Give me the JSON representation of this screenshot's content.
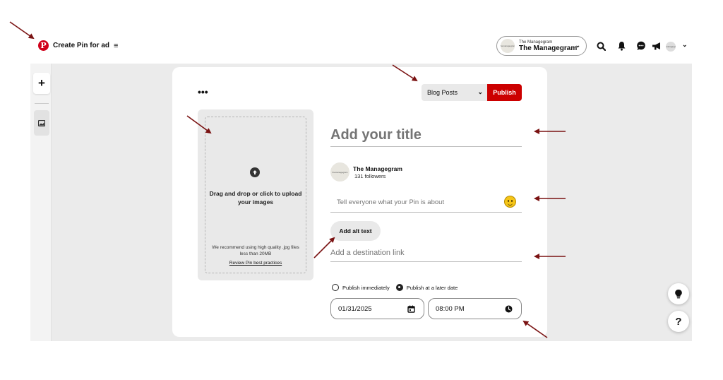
{
  "header": {
    "title": "Create Pin for ad",
    "menu_glyph": "≡",
    "logo_glyph": "P"
  },
  "account": {
    "logo_text": "themanagegram",
    "small_name": "The Managegram",
    "name": "The Managegram"
  },
  "top_icons": [
    "search-icon",
    "bell-icon",
    "chat-icon",
    "megaphone-icon"
  ],
  "avatar_text": "themanagegram",
  "rail": {
    "plus_label": "+"
  },
  "card": {
    "more_label": "•••",
    "board_select": "Blog Posts",
    "publish_label": "Publish"
  },
  "upload": {
    "instruction": "Drag and drop or click to upload your images",
    "recommend": "We recommend using high quality .jpg files less than 20MB",
    "review_link": "Review Pin best practices"
  },
  "form": {
    "title_placeholder": "Add your title",
    "profile_avatar_text": "themanagegram",
    "profile_name": "The Managegram",
    "followers": "131 followers",
    "description_placeholder": "Tell everyone what your Pin is about",
    "alt_text_label": "Add alt text",
    "link_placeholder": "Add a destination link",
    "publish_options": [
      {
        "label": "Publish immediately",
        "selected": false
      },
      {
        "label": "Publish at a later date",
        "selected": true
      }
    ],
    "date_value": "01/31/2025",
    "time_value": "08:00 PM"
  },
  "floating": {
    "idea_glyph": "💡",
    "help_label": "?"
  },
  "colors": {
    "brand_red": "#cc0000",
    "arrow": "#7a1212",
    "canvas_gray": "#ebebeb"
  }
}
